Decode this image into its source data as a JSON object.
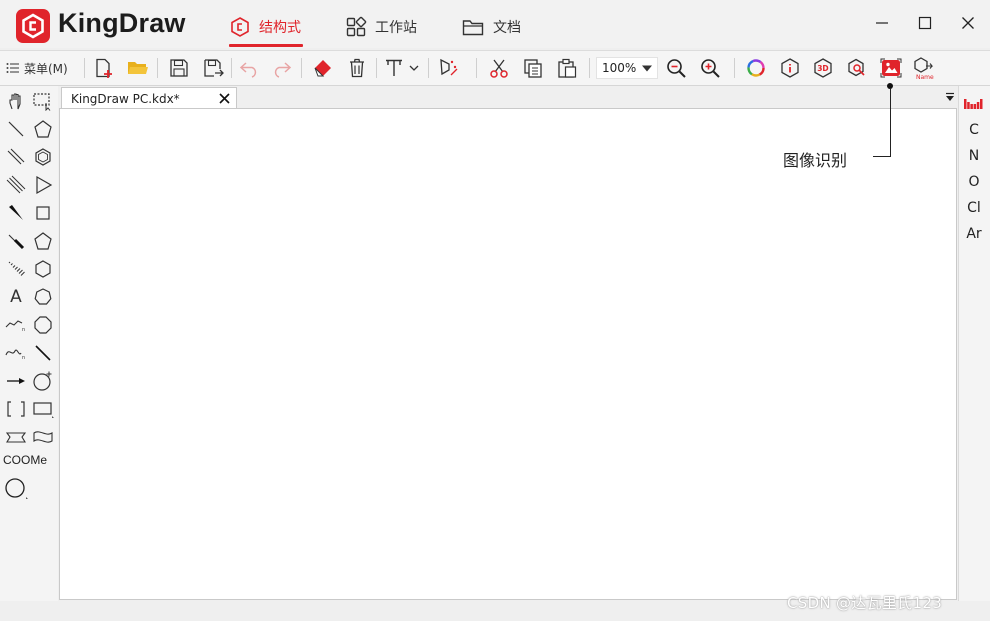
{
  "app": {
    "name": "KingDraw"
  },
  "nav_tabs": [
    {
      "label": "结构式"
    },
    {
      "label": "工作站"
    },
    {
      "label": "文档"
    }
  ],
  "toolbar": {
    "menu_label": "菜单(M)",
    "zoom_value": "100%"
  },
  "document": {
    "tab_title": "KingDraw PC.kdx*"
  },
  "left_tools": {
    "text_tool": "A",
    "group_tool": "COOMe"
  },
  "elements": [
    "C",
    "N",
    "O",
    "Cl",
    "Ar"
  ],
  "callout": {
    "label": "图像识别"
  },
  "watermark": "CSDN @达瓦里氏123",
  "colors": {
    "brand": "#e0242b",
    "accent_yellow": "#e8b01c",
    "canvas": "#ffffff"
  }
}
